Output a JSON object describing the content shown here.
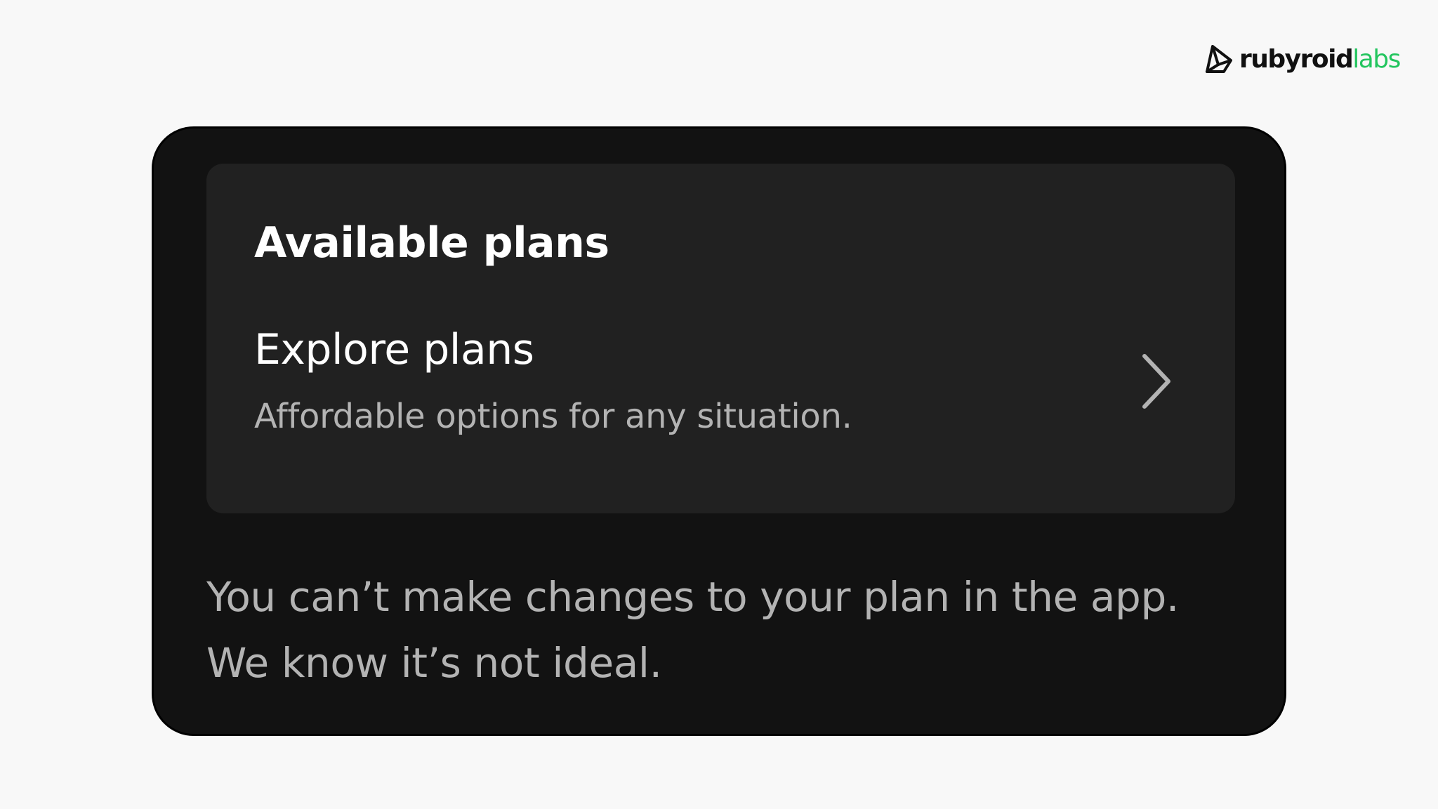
{
  "logo": {
    "primary": "rubyroid",
    "accent": "labs",
    "accent_color": "#22c55e"
  },
  "card": {
    "title": "Available plans",
    "row": {
      "title": "Explore plans",
      "subtitle": "Affordable options for any situation.",
      "icon": "chevron-right-icon"
    }
  },
  "notice": {
    "line1": "You can’t make changes to your plan in the app.",
    "line2": "We know it’s not ideal."
  },
  "colors": {
    "page_background": "#f8f8f8",
    "device_background": "#121212",
    "card_background": "#212121",
    "secondary_text": "#b3b3b3"
  }
}
